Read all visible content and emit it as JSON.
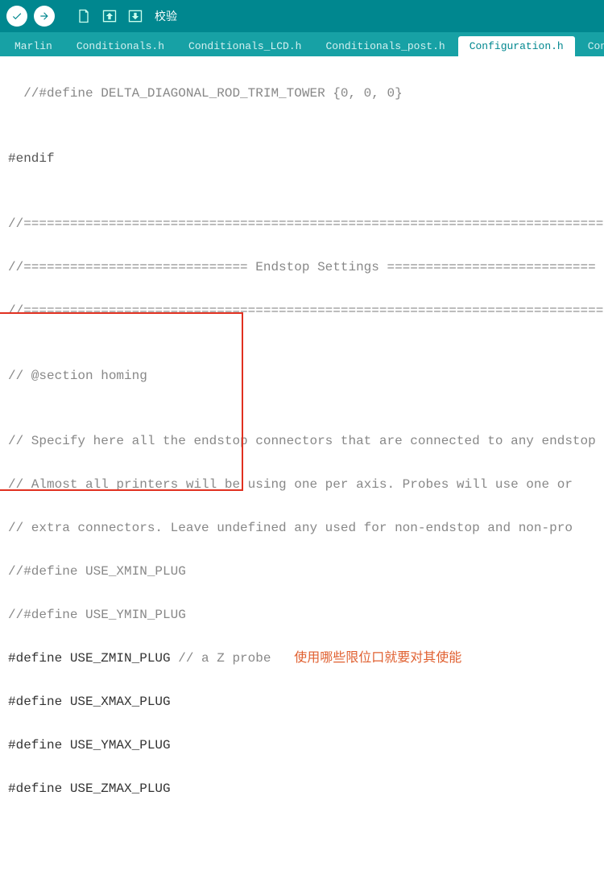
{
  "toolbar": {
    "verify_tooltip": "校验"
  },
  "tabs": [
    {
      "label": "Marlin"
    },
    {
      "label": "Conditionals.h"
    },
    {
      "label": "Conditionals_LCD.h"
    },
    {
      "label": "Conditionals_post.h"
    },
    {
      "label": "Configuration.h",
      "active": true
    },
    {
      "label": "Configuration_a"
    }
  ],
  "code": {
    "l1_indent": "  ",
    "l1": "//#define DELTA_DIAGONAL_ROD_TRIM_TOWER {0, 0, 0}",
    "l2": "",
    "l3": "#endif",
    "l4": "",
    "l5": "//===========================================================================",
    "l6": "//============================= Endstop Settings ===========================",
    "l7": "//===========================================================================",
    "l8": "",
    "l9": "// @section homing",
    "l10": "",
    "l11": "// Specify here all the endstop connectors that are connected to any endstop",
    "l12": "// Almost all printers will be using one per axis. Probes will use one or",
    "l13": "// extra connectors. Leave undefined any used for non-endstop and non-pro",
    "l14": "//#define USE_XMIN_PLUG",
    "l15": "//#define USE_YMIN_PLUG",
    "l16a": "#define USE_ZMIN_PLUG",
    "l16b": " // a Z probe   ",
    "l16c": "使用哪些限位口就要对其使能",
    "l17": "#define USE_XMAX_PLUG",
    "l18": "#define USE_YMAX_PLUG",
    "l19": "#define USE_ZMAX_PLUG"
  }
}
